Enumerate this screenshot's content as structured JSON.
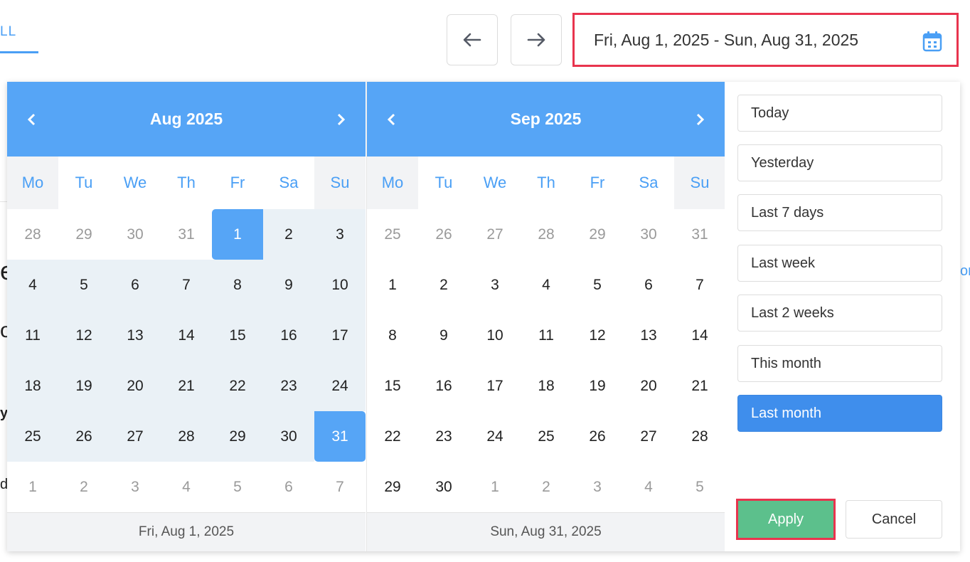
{
  "tab": {
    "label": "LL"
  },
  "date_range": {
    "value": "Fri, Aug 1, 2025 - Sun, Aug 31, 2025"
  },
  "background": {
    "frag_e": "e",
    "frag_o": "o",
    "frag_y": "y",
    "frag_dy": "dy",
    "link_frag": "on"
  },
  "calendars": [
    {
      "month_label": "Aug 2025",
      "weekdays": [
        "Mo",
        "Tu",
        "We",
        "Th",
        "Fr",
        "Sa",
        "Su"
      ],
      "footer": "Fri, Aug 1, 2025",
      "days": [
        {
          "d": "28",
          "s": "muted"
        },
        {
          "d": "29",
          "s": "muted"
        },
        {
          "d": "30",
          "s": "muted"
        },
        {
          "d": "31",
          "s": "muted"
        },
        {
          "d": "1",
          "s": "sel sel-start"
        },
        {
          "d": "2",
          "s": "inrange"
        },
        {
          "d": "3",
          "s": "inrange"
        },
        {
          "d": "4",
          "s": "inrange"
        },
        {
          "d": "5",
          "s": "inrange"
        },
        {
          "d": "6",
          "s": "inrange"
        },
        {
          "d": "7",
          "s": "inrange"
        },
        {
          "d": "8",
          "s": "inrange"
        },
        {
          "d": "9",
          "s": "inrange"
        },
        {
          "d": "10",
          "s": "inrange"
        },
        {
          "d": "11",
          "s": "inrange"
        },
        {
          "d": "12",
          "s": "inrange"
        },
        {
          "d": "13",
          "s": "inrange"
        },
        {
          "d": "14",
          "s": "inrange"
        },
        {
          "d": "15",
          "s": "inrange"
        },
        {
          "d": "16",
          "s": "inrange"
        },
        {
          "d": "17",
          "s": "inrange"
        },
        {
          "d": "18",
          "s": "inrange"
        },
        {
          "d": "19",
          "s": "inrange"
        },
        {
          "d": "20",
          "s": "inrange"
        },
        {
          "d": "21",
          "s": "inrange"
        },
        {
          "d": "22",
          "s": "inrange"
        },
        {
          "d": "23",
          "s": "inrange"
        },
        {
          "d": "24",
          "s": "inrange"
        },
        {
          "d": "25",
          "s": "inrange"
        },
        {
          "d": "26",
          "s": "inrange"
        },
        {
          "d": "27",
          "s": "inrange"
        },
        {
          "d": "28",
          "s": "inrange"
        },
        {
          "d": "29",
          "s": "inrange"
        },
        {
          "d": "30",
          "s": "inrange"
        },
        {
          "d": "31",
          "s": "sel sel-end"
        },
        {
          "d": "1",
          "s": "muted"
        },
        {
          "d": "2",
          "s": "muted"
        },
        {
          "d": "3",
          "s": "muted"
        },
        {
          "d": "4",
          "s": "muted"
        },
        {
          "d": "5",
          "s": "muted"
        },
        {
          "d": "6",
          "s": "muted"
        },
        {
          "d": "7",
          "s": "muted"
        }
      ]
    },
    {
      "month_label": "Sep 2025",
      "weekdays": [
        "Mo",
        "Tu",
        "We",
        "Th",
        "Fr",
        "Sa",
        "Su"
      ],
      "footer": "Sun, Aug 31, 2025",
      "days": [
        {
          "d": "25",
          "s": "muted"
        },
        {
          "d": "26",
          "s": "muted"
        },
        {
          "d": "27",
          "s": "muted"
        },
        {
          "d": "28",
          "s": "muted"
        },
        {
          "d": "29",
          "s": "muted"
        },
        {
          "d": "30",
          "s": "muted"
        },
        {
          "d": "31",
          "s": "muted"
        },
        {
          "d": "1",
          "s": ""
        },
        {
          "d": "2",
          "s": ""
        },
        {
          "d": "3",
          "s": ""
        },
        {
          "d": "4",
          "s": ""
        },
        {
          "d": "5",
          "s": ""
        },
        {
          "d": "6",
          "s": ""
        },
        {
          "d": "7",
          "s": ""
        },
        {
          "d": "8",
          "s": ""
        },
        {
          "d": "9",
          "s": ""
        },
        {
          "d": "10",
          "s": ""
        },
        {
          "d": "11",
          "s": ""
        },
        {
          "d": "12",
          "s": ""
        },
        {
          "d": "13",
          "s": ""
        },
        {
          "d": "14",
          "s": ""
        },
        {
          "d": "15",
          "s": ""
        },
        {
          "d": "16",
          "s": ""
        },
        {
          "d": "17",
          "s": ""
        },
        {
          "d": "18",
          "s": ""
        },
        {
          "d": "19",
          "s": ""
        },
        {
          "d": "20",
          "s": ""
        },
        {
          "d": "21",
          "s": ""
        },
        {
          "d": "22",
          "s": ""
        },
        {
          "d": "23",
          "s": ""
        },
        {
          "d": "24",
          "s": ""
        },
        {
          "d": "25",
          "s": ""
        },
        {
          "d": "26",
          "s": ""
        },
        {
          "d": "27",
          "s": ""
        },
        {
          "d": "28",
          "s": ""
        },
        {
          "d": "29",
          "s": ""
        },
        {
          "d": "30",
          "s": ""
        },
        {
          "d": "1",
          "s": "muted"
        },
        {
          "d": "2",
          "s": "muted"
        },
        {
          "d": "3",
          "s": "muted"
        },
        {
          "d": "4",
          "s": "muted"
        },
        {
          "d": "5",
          "s": "muted"
        }
      ]
    }
  ],
  "presets": [
    {
      "label": "Today",
      "active": false
    },
    {
      "label": "Yesterday",
      "active": false
    },
    {
      "label": "Last 7 days",
      "active": false
    },
    {
      "label": "Last week",
      "active": false
    },
    {
      "label": "Last 2 weeks",
      "active": false
    },
    {
      "label": "This month",
      "active": false
    },
    {
      "label": "Last month",
      "active": true
    }
  ],
  "actions": {
    "apply_label": "Apply",
    "cancel_label": "Cancel"
  },
  "colors": {
    "accent": "#56a5f6",
    "apply": "#5cc08c",
    "highlight_border": "#e8344e",
    "range": "#eaf1f6"
  }
}
